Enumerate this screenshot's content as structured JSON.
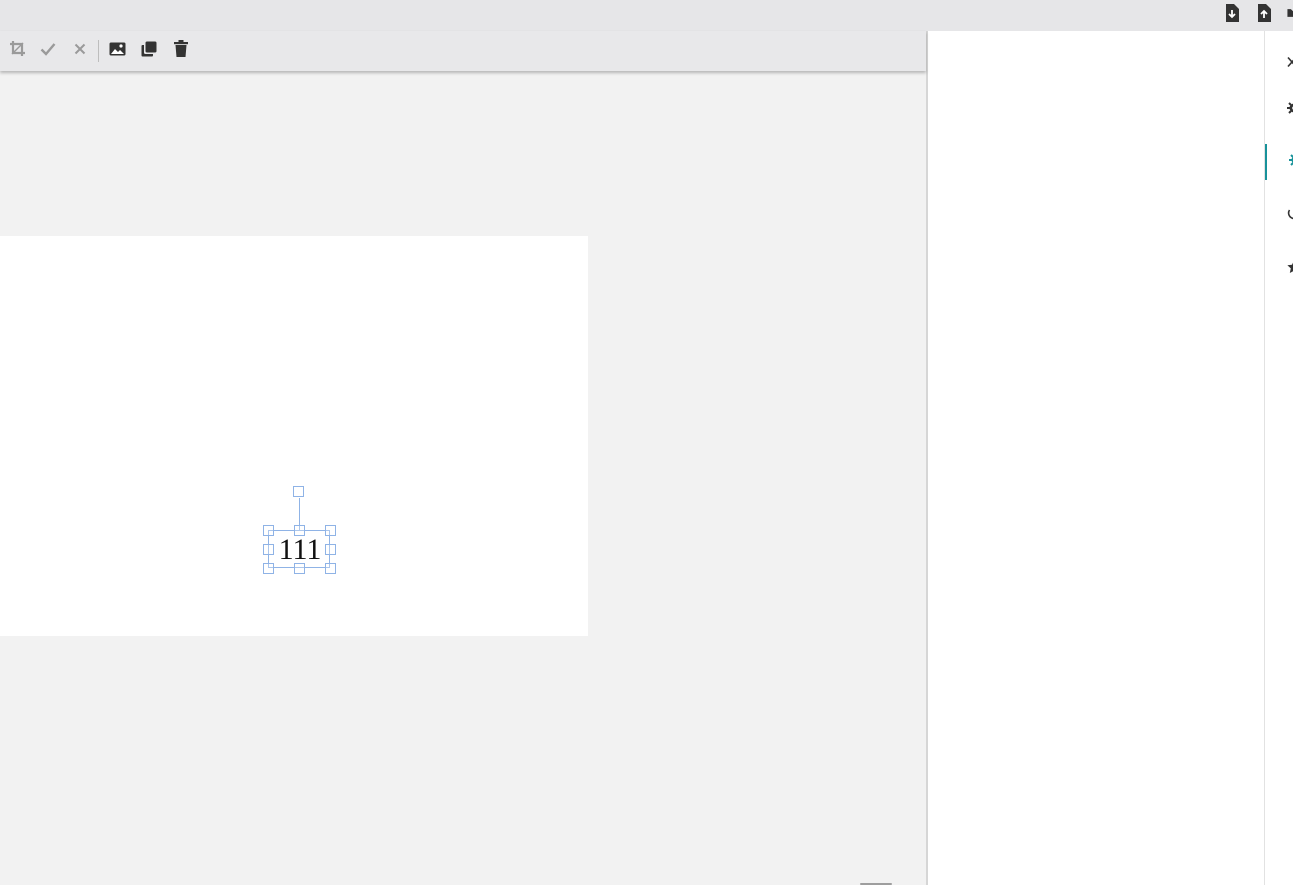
{
  "colors": {
    "accent": "#18929a",
    "icon": "#333333",
    "icon_disabled": "#9a9a9a",
    "selection": "#8fb3e6"
  },
  "topbar": {
    "icons": [
      "file-download-icon",
      "file-upload-icon",
      "file-icon"
    ]
  },
  "toolbar": {
    "tools": [
      {
        "icon": "crop-icon",
        "enabled": false
      },
      {
        "icon": "check-icon",
        "enabled": false
      },
      {
        "icon": "close-icon",
        "enabled": false
      },
      {
        "icon": "image-icon",
        "enabled": true
      },
      {
        "icon": "copy-icon",
        "enabled": true
      },
      {
        "icon": "trash-icon",
        "enabled": true
      }
    ]
  },
  "canvas": {
    "text_object": "111"
  },
  "side_strip": {
    "items": [
      {
        "icon": "close-icon",
        "active": false
      },
      {
        "icon": "gear-icon",
        "active": false
      },
      {
        "icon": "gear-icon",
        "active": true
      },
      {
        "icon": "history-icon",
        "active": false
      },
      {
        "icon": "star-icon",
        "active": false
      }
    ]
  }
}
